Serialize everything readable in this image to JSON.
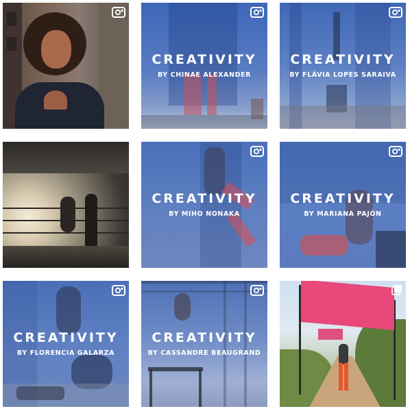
{
  "colors": {
    "overlay_blue": "#4f73b8",
    "banner_pink": "#e8487a"
  },
  "icons": {
    "video": "video-camera-icon",
    "carousel": "multiple-images-icon"
  },
  "posts": [
    {
      "type": "photo",
      "subject": "",
      "icon": "video-camera-icon"
    },
    {
      "type": "video",
      "title": "CREATIVITY",
      "byline": "BY CHINAE ALEXANDER",
      "icon": "video-camera-icon"
    },
    {
      "type": "video",
      "title": "CREATIVITY",
      "byline": "BY FLÁVIA LOPES SARAIVA",
      "icon": "video-camera-icon"
    },
    {
      "type": "photo",
      "subject": "",
      "icon": ""
    },
    {
      "type": "video",
      "title": "CREATIVITY",
      "byline": "BY MIHO NONAKA",
      "icon": "video-camera-icon"
    },
    {
      "type": "video",
      "title": "CREATIVITY",
      "byline": "BY MARIANA PAJÓN",
      "icon": "video-camera-icon"
    },
    {
      "type": "video",
      "title": "CREATIVITY",
      "byline": "BY FLORENCIA GALARZA",
      "icon": "video-camera-icon"
    },
    {
      "type": "video",
      "title": "CREATIVITY",
      "byline": "BY CASSANDRE BEAUGRAND",
      "icon": "video-camera-icon"
    },
    {
      "type": "carousel",
      "subject": "",
      "icon": "multiple-images-icon"
    }
  ]
}
